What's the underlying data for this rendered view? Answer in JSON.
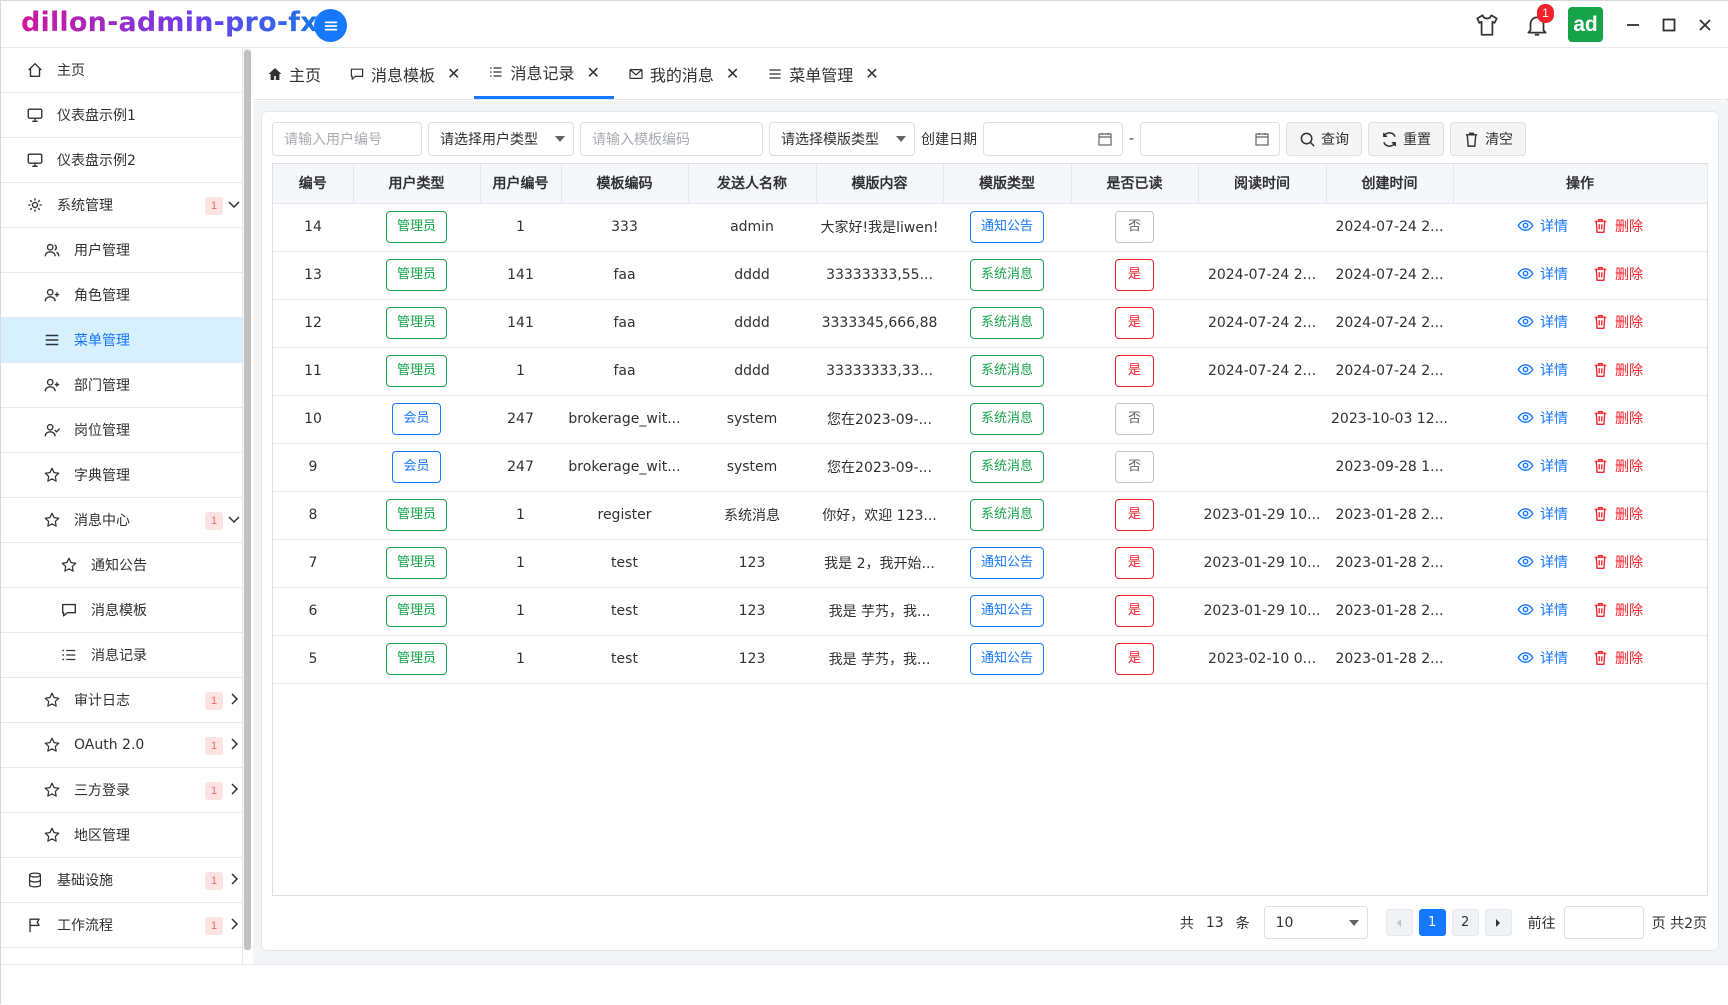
{
  "app": {
    "title": "dillon-admin-pro-fx",
    "notify_count": "1",
    "avatar_text": "ad"
  },
  "sidebar": {
    "items": [
      {
        "label": "主页",
        "icon": "home-icon",
        "level": 0
      },
      {
        "label": "仪表盘示例1",
        "icon": "monitor-icon",
        "level": 0
      },
      {
        "label": "仪表盘示例2",
        "icon": "monitor-icon",
        "level": 0
      },
      {
        "label": "系统管理",
        "icon": "gear-icon",
        "level": 0,
        "badge": "1",
        "expanded": true
      },
      {
        "label": "用户管理",
        "icon": "users-icon",
        "level": 1
      },
      {
        "label": "角色管理",
        "icon": "user-plus-icon",
        "level": 1
      },
      {
        "label": "菜单管理",
        "icon": "menu-icon",
        "level": 1,
        "active": true
      },
      {
        "label": "部门管理",
        "icon": "user-plus-icon",
        "level": 1
      },
      {
        "label": "岗位管理",
        "icon": "user-check-icon",
        "level": 1
      },
      {
        "label": "字典管理",
        "icon": "star-icon",
        "level": 1
      },
      {
        "label": "消息中心",
        "icon": "star-icon",
        "level": 1,
        "badge": "1",
        "expanded": true
      },
      {
        "label": "通知公告",
        "icon": "star-icon",
        "level": 2
      },
      {
        "label": "消息模板",
        "icon": "comment-icon",
        "level": 2
      },
      {
        "label": "消息记录",
        "icon": "list-icon",
        "level": 2
      },
      {
        "label": "审计日志",
        "icon": "star-icon",
        "level": 1,
        "badge": "1",
        "expanded": false
      },
      {
        "label": "OAuth 2.0",
        "icon": "star-icon",
        "level": 1,
        "badge": "1",
        "expanded": false
      },
      {
        "label": "三方登录",
        "icon": "star-icon",
        "level": 1,
        "badge": "1",
        "expanded": false
      },
      {
        "label": "地区管理",
        "icon": "star-icon",
        "level": 1
      },
      {
        "label": "基础设施",
        "icon": "database-icon",
        "level": 0,
        "badge": "1",
        "expanded": false
      },
      {
        "label": "工作流程",
        "icon": "flag-icon",
        "level": 0,
        "badge": "1",
        "expanded": false
      }
    ]
  },
  "tabs": [
    {
      "label": "主页",
      "icon": "home-icon",
      "closable": false
    },
    {
      "label": "消息模板",
      "icon": "comment-icon",
      "closable": true
    },
    {
      "label": "消息记录",
      "icon": "list-icon",
      "closable": true,
      "active": true
    },
    {
      "label": "我的消息",
      "icon": "mail-icon",
      "closable": true
    },
    {
      "label": "菜单管理",
      "icon": "menu-icon",
      "closable": true
    }
  ],
  "filters": {
    "user_no_placeholder": "请输入用户编号",
    "user_type_placeholder": "请选择用户类型",
    "template_code_placeholder": "请输入模板编码",
    "template_type_placeholder": "请选择模版类型",
    "create_date_label": "创建日期",
    "date_separator": "-",
    "query_label": "查询",
    "reset_label": "重置",
    "clear_label": "清空"
  },
  "table": {
    "columns": [
      "编号",
      "用户类型",
      "用户编号",
      "模板编码",
      "发送人名称",
      "模版内容",
      "模版类型",
      "是否已读",
      "阅读时间",
      "创建时间",
      "操作"
    ],
    "view_label": "详情",
    "delete_label": "删除",
    "rows": [
      {
        "id": "14",
        "user_type": "管理员",
        "user_no": "1",
        "code": "333",
        "sender": "admin",
        "content": "大家好!我是liwen!",
        "tpl_type": "通知公告",
        "read": "否",
        "read_time": "",
        "create_time": "2024-07-24 2..."
      },
      {
        "id": "13",
        "user_type": "管理员",
        "user_no": "141",
        "code": "faa",
        "sender": "dddd",
        "content": "33333333,55...",
        "tpl_type": "系统消息",
        "read": "是",
        "read_time": "2024-07-24 2...",
        "create_time": "2024-07-24 2..."
      },
      {
        "id": "12",
        "user_type": "管理员",
        "user_no": "141",
        "code": "faa",
        "sender": "dddd",
        "content": "3333345,666,88",
        "tpl_type": "系统消息",
        "read": "是",
        "read_time": "2024-07-24 2...",
        "create_time": "2024-07-24 2..."
      },
      {
        "id": "11",
        "user_type": "管理员",
        "user_no": "1",
        "code": "faa",
        "sender": "dddd",
        "content": "33333333,33...",
        "tpl_type": "系统消息",
        "read": "是",
        "read_time": "2024-07-24 2...",
        "create_time": "2024-07-24 2..."
      },
      {
        "id": "10",
        "user_type": "会员",
        "user_no": "247",
        "code": "brokerage_wit...",
        "sender": "system",
        "content": "您在2023-09-...",
        "tpl_type": "系统消息",
        "read": "否",
        "read_time": "",
        "create_time": "2023-10-03 12..."
      },
      {
        "id": "9",
        "user_type": "会员",
        "user_no": "247",
        "code": "brokerage_wit...",
        "sender": "system",
        "content": "您在2023-09-...",
        "tpl_type": "系统消息",
        "read": "否",
        "read_time": "",
        "create_time": "2023-09-28 1..."
      },
      {
        "id": "8",
        "user_type": "管理员",
        "user_no": "1",
        "code": "register",
        "sender": "系统消息",
        "content": "你好，欢迎 123...",
        "tpl_type": "系统消息",
        "read": "是",
        "read_time": "2023-01-29 10...",
        "create_time": "2023-01-28 2..."
      },
      {
        "id": "7",
        "user_type": "管理员",
        "user_no": "1",
        "code": "test",
        "sender": "123",
        "content": "我是 2，我开始...",
        "tpl_type": "通知公告",
        "read": "是",
        "read_time": "2023-01-29 10...",
        "create_time": "2023-01-28 2..."
      },
      {
        "id": "6",
        "user_type": "管理员",
        "user_no": "1",
        "code": "test",
        "sender": "123",
        "content": "我是 芋艿，我...",
        "tpl_type": "通知公告",
        "read": "是",
        "read_time": "2023-01-29 10...",
        "create_time": "2023-01-28 2..."
      },
      {
        "id": "5",
        "user_type": "管理员",
        "user_no": "1",
        "code": "test",
        "sender": "123",
        "content": "我是 芋艿，我...",
        "tpl_type": "通知公告",
        "read": "是",
        "read_time": "2023-02-10 0...",
        "create_time": "2023-01-28 2..."
      }
    ]
  },
  "pager": {
    "total_prefix": "共",
    "total": "13",
    "total_suffix": "条",
    "page_size": "10",
    "pages": [
      "1",
      "2"
    ],
    "current": "1",
    "goto_label": "前往",
    "page_suffix": "页 共2页"
  },
  "colors": {
    "accent": "#1677ff",
    "success": "#16a34a",
    "danger": "#f5222d"
  }
}
